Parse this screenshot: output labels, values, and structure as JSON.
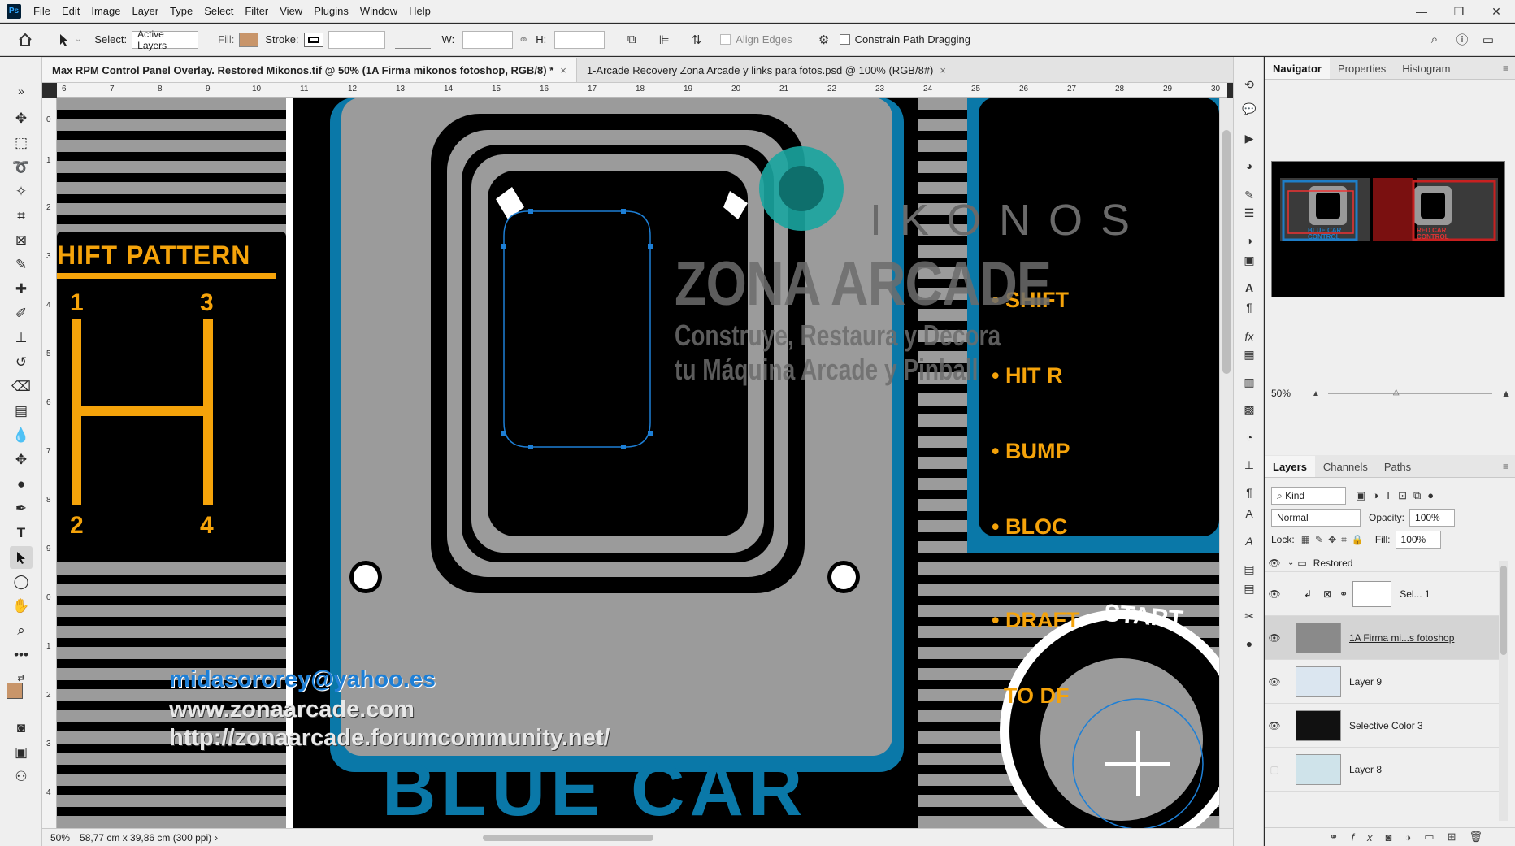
{
  "menubar": {
    "logo": "Ps",
    "items": [
      "File",
      "Edit",
      "Image",
      "Layer",
      "Type",
      "Select",
      "Filter",
      "View",
      "Plugins",
      "Window",
      "Help"
    ],
    "window_controls": [
      "—",
      "❐",
      "✕"
    ]
  },
  "options": {
    "select_label": "Select:",
    "select_value": "Active Layers",
    "fill_label": "Fill:",
    "fill_color": "#c8956a",
    "stroke_label": "Stroke:",
    "w_label": "W:",
    "h_label": "H:",
    "align_edges": "Align Edges",
    "constrain": "Constrain Path Dragging"
  },
  "tabs": [
    {
      "label": "Max RPM Control Panel Overlay. Restored Mikonos.tif @ 50% (1A Firma mikonos fotoshop, RGB/8) *",
      "close": "×"
    },
    {
      "label": "1-Arcade Recovery Zona Arcade y links para fotos.psd @ 100% (RGB/8#)",
      "close": "×"
    }
  ],
  "ruler": {
    "top": [
      "6",
      "7",
      "8",
      "9",
      "10",
      "11",
      "12",
      "13",
      "14",
      "15",
      "16",
      "17",
      "18",
      "19",
      "20",
      "21",
      "22",
      "23",
      "24",
      "25",
      "26",
      "27",
      "28",
      "29",
      "30"
    ],
    "left": [
      "0",
      "1",
      "2",
      "3",
      "4",
      "5",
      "6",
      "7",
      "8",
      "9",
      "0",
      "1",
      "2",
      "3",
      "4"
    ]
  },
  "artwork": {
    "shift_title": "HIFT PATTERN",
    "gear_1": "1",
    "gear_2": "2",
    "gear_3": "3",
    "gear_4": "4",
    "right_lines": [
      "• SHIFT",
      "• HIT R",
      "• BUMP",
      "• BLOC",
      "• DRAFT",
      "  TO DF"
    ],
    "start": "START",
    "blue_car": "BLUE CAR",
    "wm_brand": "IKONOS",
    "wm_title": "ZONA ARCADE",
    "wm_line1": "Construye, Restaura y Decora",
    "wm_line2": "tu Máquina Arcade y Pinball",
    "email": "midasororey@yahoo.es",
    "site1": "www.zonaarcade.com",
    "site2": "http://zonaarcade.forumcommunity.net/"
  },
  "status": {
    "zoom": "50%",
    "doc_size": "58,77 cm x 39,86 cm (300 ppi)",
    "arrow": "›"
  },
  "panels": {
    "top_tabs": [
      "Navigator",
      "Properties",
      "Histogram"
    ],
    "navigator_zoom": "50%",
    "layer_tabs": [
      "Layers",
      "Channels",
      "Paths"
    ],
    "kind_label": "Kind",
    "blend_mode": "Normal",
    "opacity_label": "Opacity:",
    "opacity_value": "100%",
    "lock_label": "Lock:",
    "fill_label": "Fill:",
    "fill_value": "100%",
    "group_name": "Restored",
    "layers": [
      {
        "name": "Sel... 1"
      },
      {
        "name": "1A Firma mi...s fotoshop"
      },
      {
        "name": "Layer 9"
      },
      {
        "name": "Selective Color 3"
      },
      {
        "name": "Layer 8"
      }
    ],
    "nav_thumb_text_1": "BLUE CAR",
    "nav_thumb_text_2": "CONTROL",
    "nav_thumb_text_3": "RED CAR",
    "nav_thumb_text_4": "CONTROL"
  }
}
